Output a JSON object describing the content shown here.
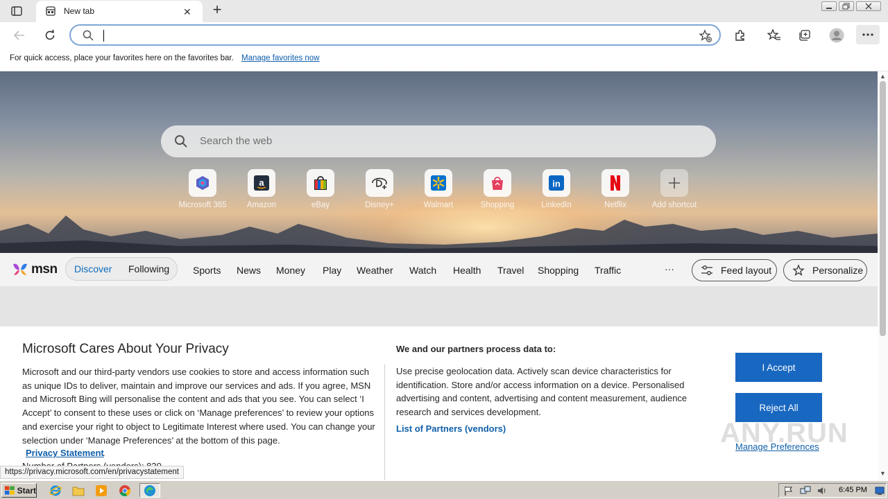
{
  "browser": {
    "tab": {
      "title": "New tab",
      "close_glyph": "✕"
    },
    "new_tab_glyph": "+",
    "address_bar": {
      "value": "",
      "placeholder": ""
    },
    "favorites_bar": {
      "message": "For quick access, place your favorites here on the favorites bar.",
      "link": "Manage favorites now"
    },
    "status_url": "https://privacy.microsoft.com/en/privacystatement"
  },
  "newtab": {
    "search_placeholder": "Search the web",
    "quick_links": [
      {
        "label": "Microsoft 365",
        "icon": "microsoft365-icon"
      },
      {
        "label": "Amazon",
        "icon": "amazon-icon"
      },
      {
        "label": "eBay",
        "icon": "ebay-icon"
      },
      {
        "label": "Disney+",
        "icon": "disneyplus-icon"
      },
      {
        "label": "Walmart",
        "icon": "walmart-icon"
      },
      {
        "label": "Shopping",
        "icon": "shopping-icon"
      },
      {
        "label": "LinkedIn",
        "icon": "linkedin-icon"
      },
      {
        "label": "Netflix",
        "icon": "netflix-icon"
      },
      {
        "label": "Add shortcut",
        "icon": "plus-icon"
      }
    ]
  },
  "msn": {
    "logo": "msn",
    "tabs": [
      "Discover",
      "Following"
    ],
    "nav": [
      "Sports",
      "News",
      "Money",
      "Play",
      "Weather",
      "Watch",
      "Health",
      "Travel",
      "Shopping",
      "Traffic"
    ],
    "more": "···",
    "feed_layout": "Feed layout",
    "personalize": "Personalize"
  },
  "privacy": {
    "title": "Microsoft Cares About Your Privacy",
    "body": "Microsoft and our third-party vendors use cookies to store and access information such as unique IDs to deliver, maintain and improve our services and ads. If you agree, MSN and Microsoft Bing will personalise the content and ads that you see. You can select ‘I Accept’ to consent to these uses or click on ‘Manage preferences’ to review your options and exercise your right to object to Legitimate Interest where used.  You can change your selection under ‘Manage Preferences’ at the bottom of this page.",
    "privacy_statement": "Privacy Statement",
    "partners_count": "Number of Partners (vendors): 830",
    "process_title": "We and our partners process data to:",
    "process_body": "Use precise geolocation data. Actively scan device characteristics for identification. Store and/or access information on a device. Personalised advertising and content, advertising and content measurement, audience research and services development.",
    "vendors_link": "List of Partners (vendors)",
    "accept": "I Accept",
    "reject": "Reject All",
    "manage": "Manage Preferences"
  },
  "watermark": "ANY.RUN",
  "taskbar": {
    "start": "Start",
    "clock": "6:45 PM"
  },
  "colors": {
    "accent": "#1867c0",
    "link": "#0f5fa8",
    "address_border": "#7fa6d6"
  }
}
